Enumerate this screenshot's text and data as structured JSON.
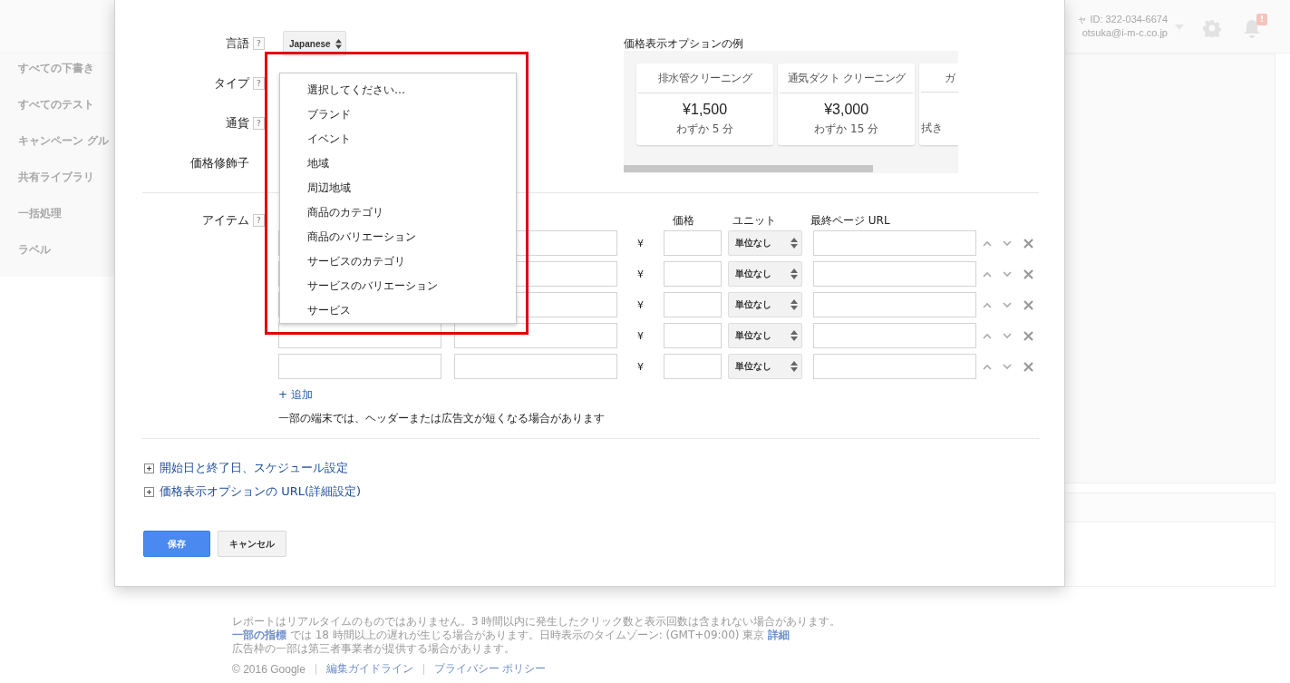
{
  "header": {
    "account_id": "ャ ID: 322-034-6674",
    "email": "otsuka@i-m-c.co.jp",
    "notification_badge": "!"
  },
  "sidebar": {
    "items": [
      "すべての下書き",
      "すべてのテスト",
      "キャンペーン グル",
      "共有ライブラリ",
      "一括処理",
      "ラベル"
    ]
  },
  "dialog": {
    "fields": [
      {
        "label": "言語",
        "help": "?",
        "value": "Japanese"
      },
      {
        "label": "タイプ",
        "help": "?"
      },
      {
        "label": "通貨",
        "help": "?"
      },
      {
        "label": "価格修飾子"
      }
    ],
    "type_dropdown": {
      "options": [
        "選択してください…",
        "ブランド",
        "イベント",
        "地域",
        "周辺地域",
        "商品のカテゴリ",
        "商品のバリエーション",
        "サービスのカテゴリ",
        "サービスのバリエーション",
        "サービス"
      ]
    },
    "preview": {
      "title": "価格表示オプションの例",
      "cards": [
        {
          "title": "排水管クリーニング",
          "price": "¥1,500",
          "subtitle": "わずか 5 分"
        },
        {
          "title": "通気ダクト クリーニング",
          "price": "¥3,000",
          "subtitle": "わずか 15 分"
        },
        {
          "title": "ガ",
          "subtitle": "拭き"
        }
      ]
    },
    "items": {
      "label": "アイテム",
      "help": "?",
      "columns": [
        "価格",
        "ユニット",
        "最終ページ URL"
      ],
      "rows": [
        {
          "currency": "¥",
          "unit": "単位なし"
        },
        {
          "currency": "¥",
          "unit": "単位なし"
        },
        {
          "currency": "¥",
          "unit": "単位なし"
        },
        {
          "currency": "¥",
          "unit": "単位なし"
        },
        {
          "currency": "¥",
          "unit": "単位なし"
        }
      ],
      "add_link": "+ 追加",
      "note": "一部の端末では、ヘッダーまたは広告文が短くなる場合があります"
    },
    "expanders": [
      {
        "label": "開始日と終了日、スケジュール設定",
        "expanded": false
      },
      {
        "label": "価格表示オプションの URL(詳細設定)",
        "expanded": false
      }
    ],
    "buttons": [
      {
        "label": "保存",
        "kind": "primary"
      },
      {
        "label": "キャンセル",
        "kind": "secondary"
      }
    ]
  },
  "footer": {
    "lines": [
      [
        {
          "text": "レポートはリアルタイムのものではありません。3 時間以内に発生したクリック数と表示回数は含まれない場合があります。",
          "link": false
        }
      ],
      [
        {
          "text": "一部の指標",
          "link": true
        },
        {
          "text": " では 18 時間以上の遅れが生じる場合があります。日時表示のタイムゾーン: (GMT+09:00) 東京 ",
          "link": false
        },
        {
          "text": "詳細",
          "link": true
        }
      ],
      [
        {
          "text": "広告枠の一部は第三者事業者が提供する場合があります。",
          "link": false
        }
      ]
    ],
    "copyright": "© 2016 Google",
    "links": [
      "編集ガイドライン",
      "プライバシー ポリシー"
    ]
  }
}
